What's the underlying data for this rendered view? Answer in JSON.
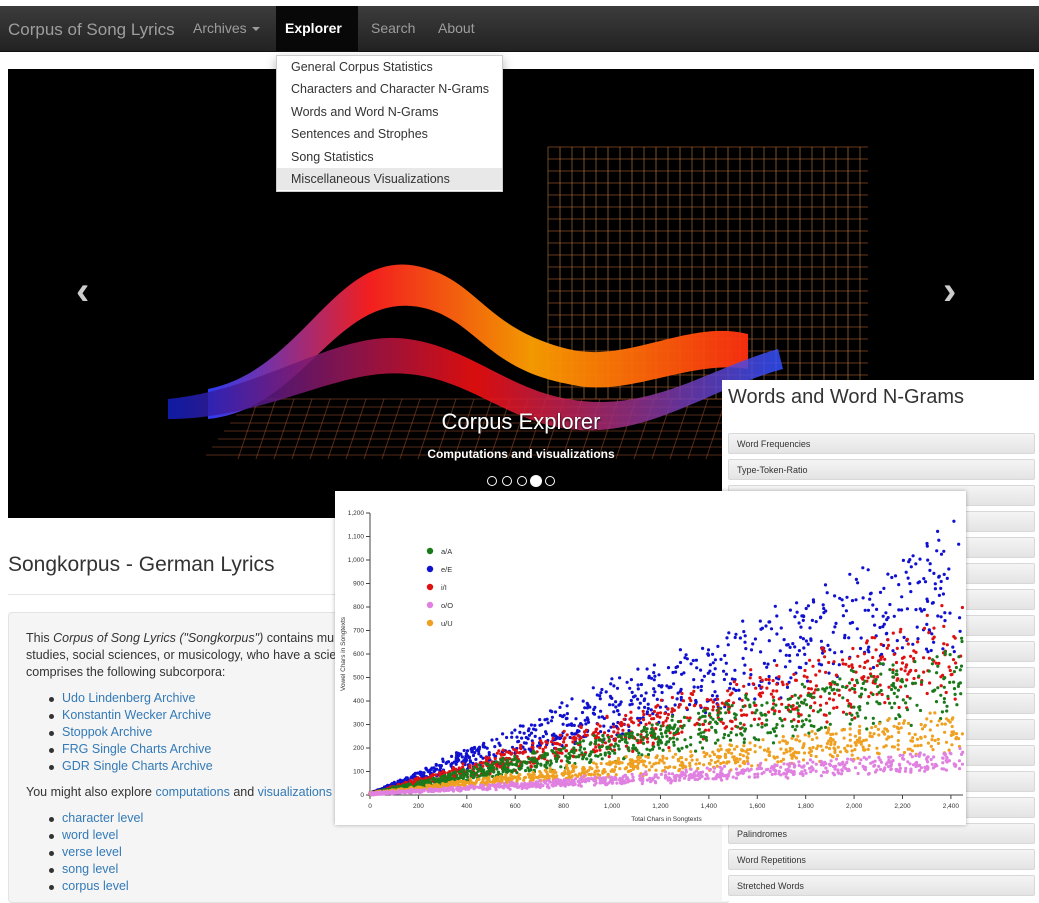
{
  "navbar": {
    "brand": "Corpus of Song Lyrics",
    "items": [
      "Archives",
      "Explorer",
      "Search",
      "About"
    ],
    "active": "Explorer"
  },
  "dropdown": {
    "items": [
      "General Corpus Statistics",
      "Characters and Character N-Grams",
      "Words and Word N-Grams",
      "Sentences and Strophes",
      "Song Statistics",
      "Miscellaneous Visualizations"
    ],
    "highlighted": "Miscellaneous Visualizations"
  },
  "carousel": {
    "caption_title": "Corpus Explorer",
    "caption_subtitle": "Computations and visualizations",
    "slide_count": 5,
    "active_slide": 4
  },
  "main": {
    "title": "Songkorpus - German Lyrics",
    "intro_prefix": "This ",
    "intro_em": "Corpus of Song Lyrics (\"Songkorpus\")",
    "intro_rest_1": " contains mu",
    "intro_line2": "studies, social sciences, or musicology, who have a scie",
    "intro_line3": "comprises the following subcorpora:",
    "subcorpora": [
      "Udo Lindenberg Archive",
      "Konstantin Wecker Archive",
      "Stoppok Archive",
      "FRG Single Charts Archive",
      "GDR Single Charts Archive"
    ],
    "explore_prefix": "You might also explore ",
    "explore_link1": "computations",
    "explore_and": " and ",
    "explore_link2": "visualizations",
    "levels": [
      "character level",
      "word level",
      "verse level",
      "song level",
      "corpus level"
    ]
  },
  "right_panel": {
    "title": "Words and Word N-Grams",
    "items_top": [
      "Word Frequencies",
      "Type-Token-Ratio"
    ],
    "items_bottom": [
      "Palindromes",
      "Word Repetitions",
      "Stretched Words"
    ]
  },
  "colors": {
    "a": "#1a7a1a",
    "e": "#1010d0",
    "i": "#e01010",
    "o": "#e080e0",
    "u": "#f0a020"
  },
  "chart_data": {
    "type": "scatter",
    "xlabel": "Total Chars in Songtexts",
    "ylabel": "Vowel Chars in Songtexts",
    "xlim": [
      0,
      2450
    ],
    "ylim": [
      0,
      1200
    ],
    "xticks": [
      "0",
      "200",
      "400",
      "600",
      "800",
      "1,000",
      "1,200",
      "1,400",
      "1,600",
      "1,800",
      "2,000",
      "2,200",
      "2,400"
    ],
    "yticks": [
      "0",
      "100",
      "200",
      "300",
      "400",
      "500",
      "600",
      "700",
      "800",
      "900",
      "1,000",
      "1,100",
      "1,200"
    ],
    "series": [
      {
        "name": "a/A",
        "slope_mean": 0.2,
        "color_key": "a"
      },
      {
        "name": "e/E",
        "slope_mean": 0.36,
        "color_key": "e"
      },
      {
        "name": "i/I",
        "slope_mean": 0.25,
        "color_key": "i"
      },
      {
        "name": "o/O",
        "slope_mean": 0.06,
        "color_key": "o"
      },
      {
        "name": "u/U",
        "slope_mean": 0.11,
        "color_key": "u"
      }
    ]
  }
}
